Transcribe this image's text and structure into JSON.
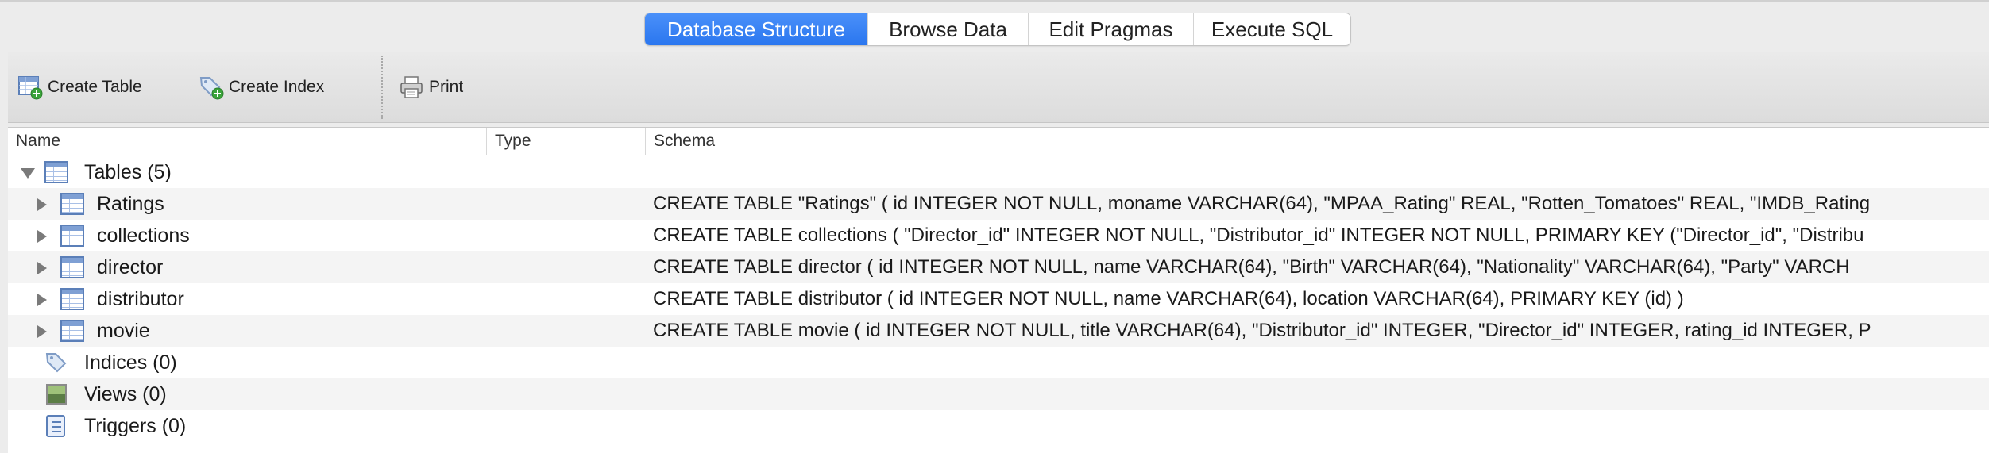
{
  "tabs": [
    {
      "label": "Database Structure",
      "active": true
    },
    {
      "label": "Browse Data",
      "active": false
    },
    {
      "label": "Edit Pragmas",
      "active": false
    },
    {
      "label": "Execute SQL",
      "active": false
    }
  ],
  "toolbar": {
    "create_table": "Create Table",
    "create_index": "Create Index",
    "print": "Print"
  },
  "columns": {
    "name": "Name",
    "type": "Type",
    "schema": "Schema"
  },
  "tree": {
    "tables_group": "Tables (5)",
    "tables": [
      {
        "name": "Ratings",
        "schema": "CREATE TABLE \"Ratings\" ( id INTEGER NOT NULL, moname VARCHAR(64), \"MPAA_Rating\" REAL, \"Rotten_Tomatoes\" REAL, \"IMDB_Rating"
      },
      {
        "name": "collections",
        "schema": "CREATE TABLE collections ( \"Director_id\" INTEGER NOT NULL, \"Distributor_id\" INTEGER NOT NULL, PRIMARY KEY (\"Director_id\", \"Distribu"
      },
      {
        "name": "director",
        "schema": "CREATE TABLE director ( id INTEGER NOT NULL, name VARCHAR(64), \"Birth\" VARCHAR(64), \"Nationality\" VARCHAR(64), \"Party\" VARCH"
      },
      {
        "name": "distributor",
        "schema": "CREATE TABLE distributor ( id INTEGER NOT NULL, name VARCHAR(64), location VARCHAR(64), PRIMARY KEY (id) )"
      },
      {
        "name": "movie",
        "schema": "CREATE TABLE movie ( id INTEGER NOT NULL, title VARCHAR(64), \"Distributor_id\" INTEGER, \"Director_id\" INTEGER, rating_id INTEGER, P"
      }
    ],
    "indices_group": "Indices (0)",
    "views_group": "Views (0)",
    "triggers_group": "Triggers (0)"
  },
  "icons": {
    "table": "table-icon",
    "index": "tag-icon",
    "view": "image-icon",
    "trigger": "script-icon",
    "print": "printer-icon"
  },
  "colors": {
    "accent": "#2f7cf6",
    "row_alt": "#f4f4f4"
  }
}
